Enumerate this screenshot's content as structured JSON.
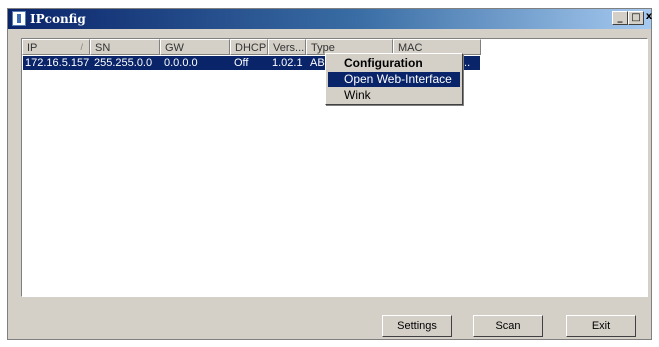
{
  "window": {
    "title": "IPconfig",
    "controls": {
      "minimize": "_",
      "maximize": "□",
      "close": "x"
    }
  },
  "table": {
    "columns": [
      "IP",
      "SN",
      "GW",
      "DHCP",
      "Vers...",
      "Type",
      "MAC"
    ],
    "sort_indicator": "/",
    "rows": [
      {
        "ip": "172.16.5.157",
        "sn": "255.255.0.0",
        "gw": "0.0.0.0",
        "dhcp": "Off",
        "version": "1.02.1",
        "type": "ABC",
        "mac": "..."
      }
    ]
  },
  "context_menu": {
    "items": [
      "Configuration",
      "Open Web-Interface",
      "Wink"
    ],
    "default_item": "Configuration",
    "highlighted_item": "Open Web-Interface"
  },
  "buttons": {
    "settings": "Settings",
    "scan": "Scan",
    "exit": "Exit"
  },
  "colors": {
    "selection": "#0a246a",
    "face": "#d4d0c8",
    "title_start": "#0a246a",
    "title_end": "#a6caf0"
  }
}
